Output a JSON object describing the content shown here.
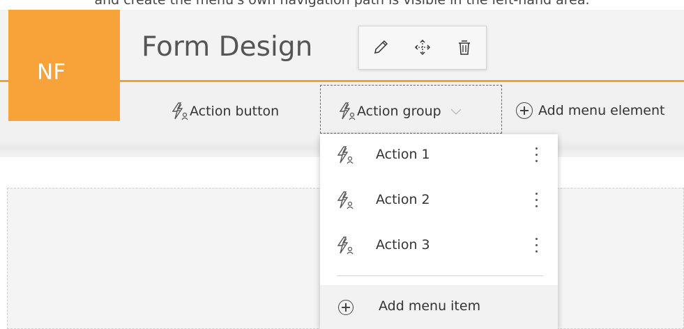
{
  "page": {
    "top_caption": "and create the menu's own navigation path is visible in the left-hand area."
  },
  "app": {
    "logo_text": "NF",
    "form_title": "Form Design"
  },
  "title_toolbar": {
    "icons": [
      "pencil-icon",
      "move-icon",
      "trash-icon"
    ]
  },
  "menubar": {
    "action_button_label": "Action button",
    "action_group_label": "Action group",
    "add_menu_element_label": "Add menu element"
  },
  "dropdown": {
    "items": [
      {
        "label": "Action 1"
      },
      {
        "label": "Action 2"
      },
      {
        "label": "Action 3"
      }
    ],
    "add_item_label": "Add menu item"
  },
  "colors": {
    "brand_orange": "#f8a23a",
    "accent_line": "#f4a03a"
  }
}
